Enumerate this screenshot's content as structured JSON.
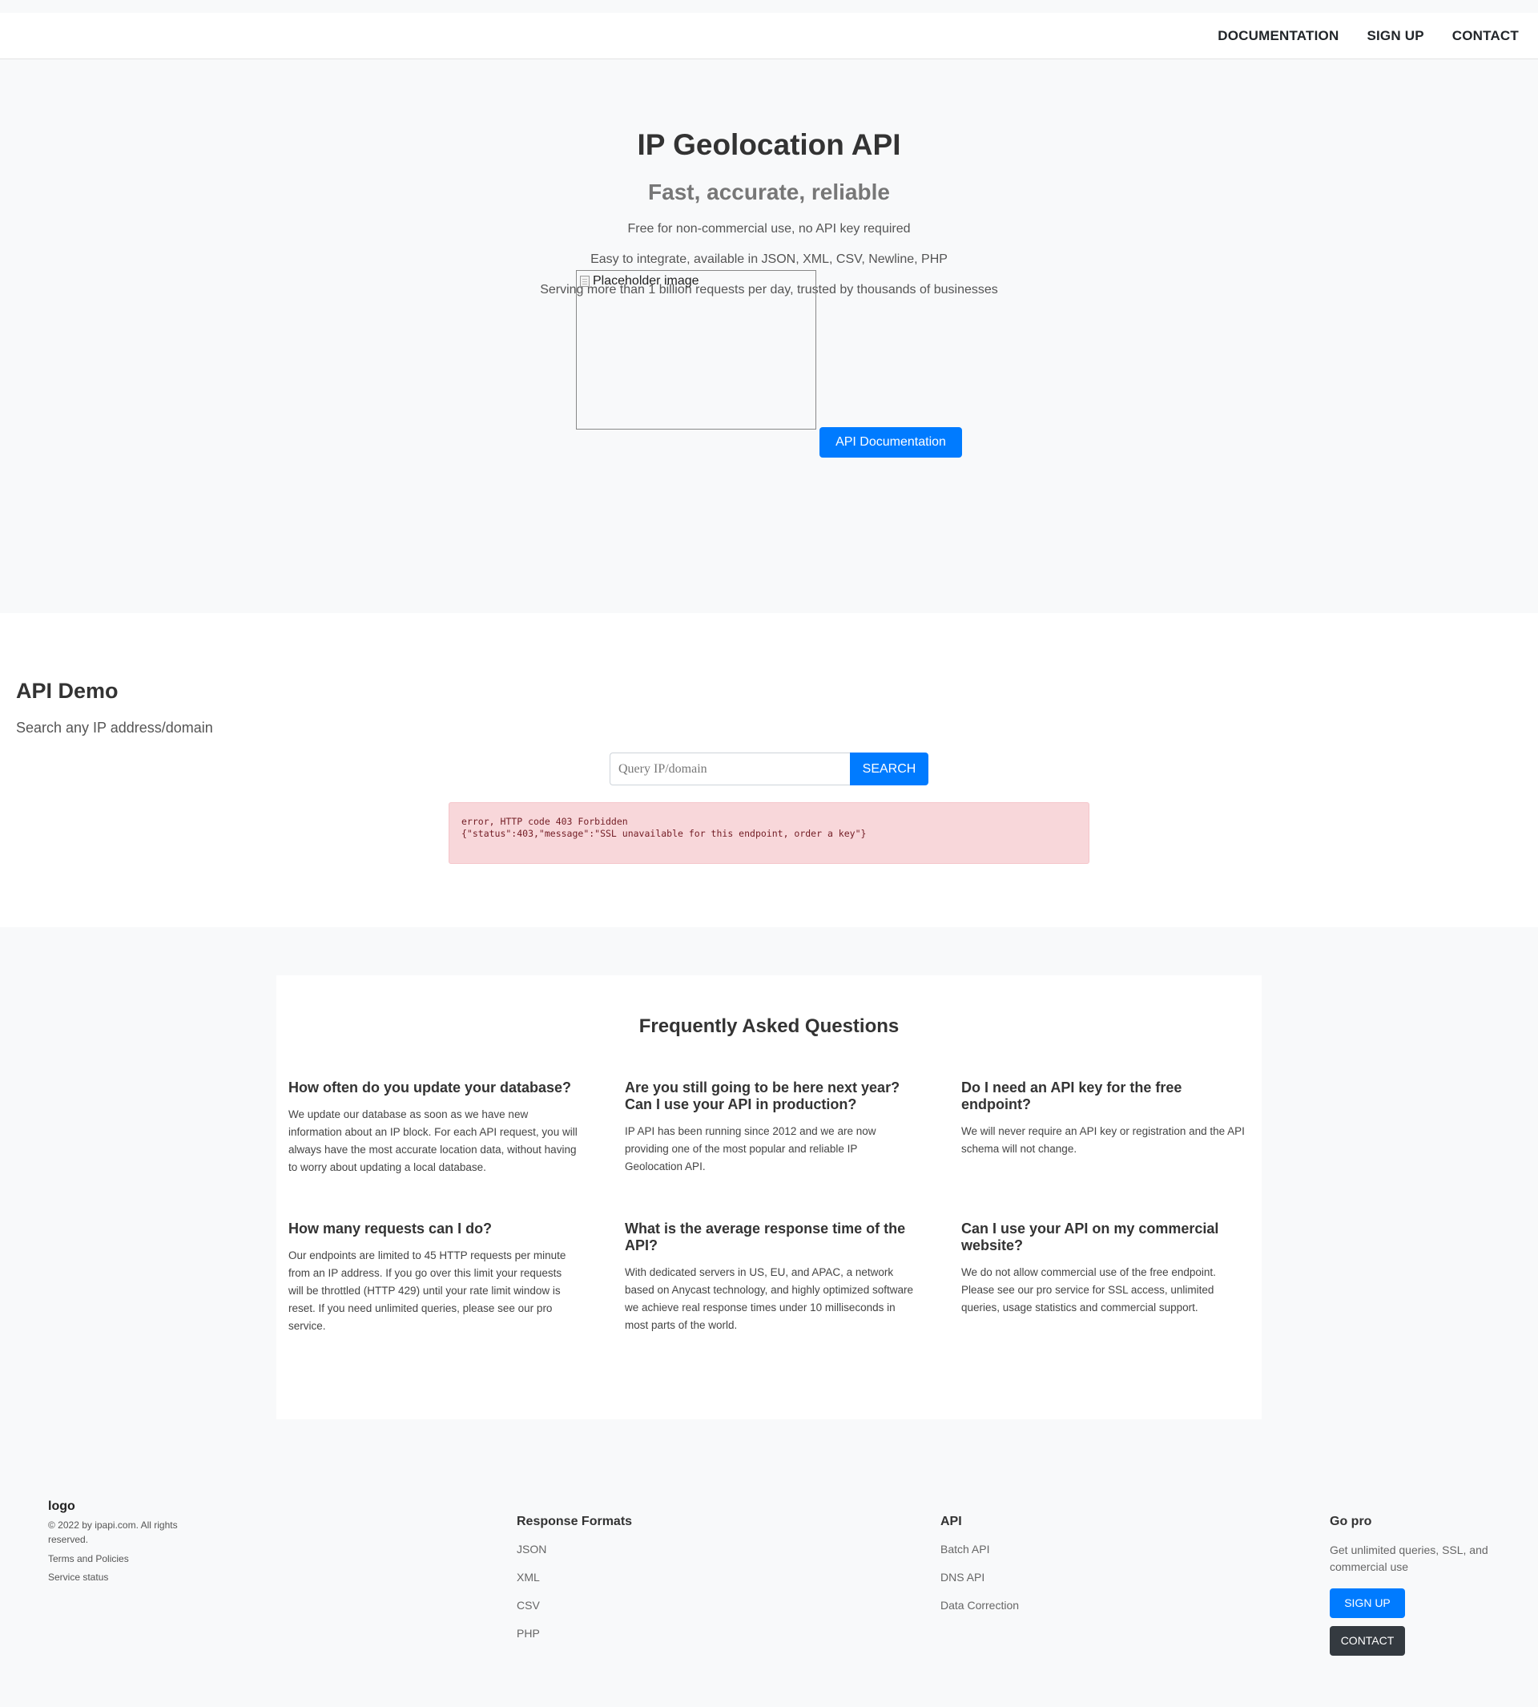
{
  "nav": {
    "documentation": "DOCUMENTATION",
    "signup": "SIGN UP",
    "contact": "CONTACT"
  },
  "hero": {
    "title": "IP Geolocation API",
    "subtitle": "Fast, accurate, reliable",
    "lines": [
      "Free for non-commercial use, no API key required",
      "Easy to integrate, available in JSON, XML, CSV, Newline, PHP",
      "Serving more than 1 billion requests per day, trusted by thousands of businesses"
    ],
    "image_alt": "Placeholder image",
    "doc_button": "API Documentation"
  },
  "demo": {
    "title": "API Demo",
    "subtitle": "Search any IP address/domain",
    "input_placeholder": "Query IP/domain",
    "input_value": "",
    "search_button": "SEARCH",
    "error_line1": "error, HTTP code 403 Forbidden",
    "error_line2": "{\"status\":403,\"message\":\"SSL unavailable for this endpoint, order a key\"}"
  },
  "faq": {
    "title": "Frequently Asked Questions",
    "items": [
      {
        "question": "How often do you update your database?",
        "answer": "We update our database as soon as we have new information about an IP block. For each API request, you will always have the most accurate location data, without having to worry about updating a local database."
      },
      {
        "question": "Are you still going to be here next year? Can I use your API in production?",
        "answer": "IP API has been running since 2012 and we are now providing one of the most popular and reliable IP Geolocation API."
      },
      {
        "question": "Do I need an API key for the free endpoint?",
        "answer": "We will never require an API key or registration and the API schema will not change."
      },
      {
        "question": "How many requests can I do?",
        "answer": "Our endpoints are limited to 45 HTTP requests per minute from an IP address. If you go over this limit your requests will be throttled (HTTP 429) until your rate limit window is reset. If you need unlimited queries, please see our pro service."
      },
      {
        "question": "What is the average response time of the API?",
        "answer": "With dedicated servers in US, EU, and APAC, a network based on Anycast technology, and highly optimized software we achieve real response times under 10 milliseconds in most parts of the world."
      },
      {
        "question": "Can I use your API on my commercial website?",
        "answer": "We do not allow commercial use of the free endpoint. Please see our pro service for SSL access, unlimited queries, usage statistics and commercial support."
      }
    ]
  },
  "footer": {
    "logo": "logo",
    "copyright": "© 2022 by ipapi.com. All rights reserved.",
    "terms": "Terms and Policies",
    "status": "Service status",
    "formats": {
      "heading": "Response Formats",
      "links": [
        "JSON",
        "XML",
        "CSV",
        "PHP"
      ]
    },
    "api": {
      "heading": "API",
      "links": [
        "Batch API",
        "DNS API",
        "Data Correction"
      ]
    },
    "pro": {
      "heading": "Go pro",
      "text": "Get unlimited queries, SSL, and commercial use",
      "signup": "SIGN UP",
      "contact": "CONTACT"
    }
  },
  "colors": {
    "primary": "#007bff",
    "dark_button": "#343a40",
    "error_bg": "#f8d7da",
    "error_text": "#721c24",
    "page_bg": "#f8f9fa"
  }
}
